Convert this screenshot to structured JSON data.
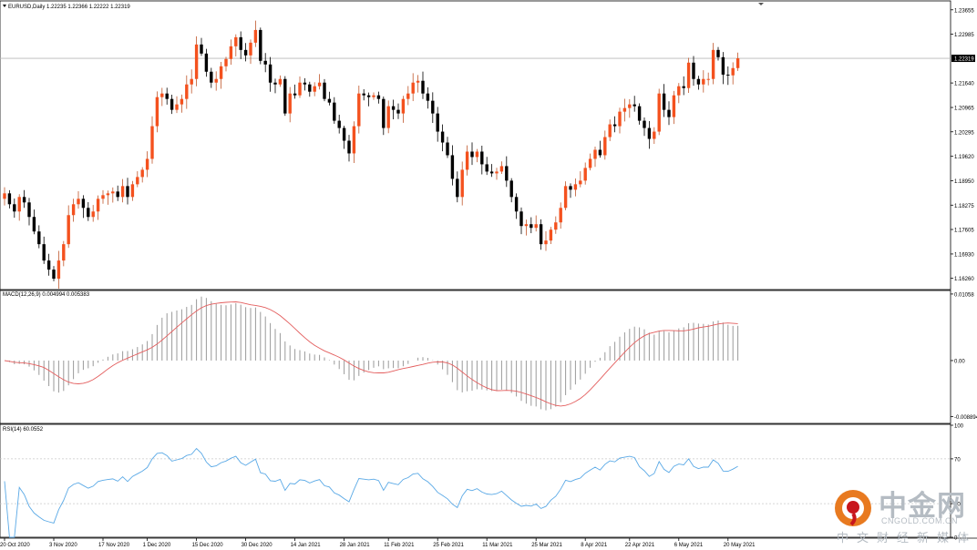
{
  "chart_data": [
    {
      "type": "candlestick",
      "panel": "price",
      "header": "EURUSD,Daily  1.22235 1.22366 1.22222 1.22319",
      "symbol": "EURUSD",
      "timeframe": "Daily",
      "last_price_label": "1.22319",
      "ylim": [
        1.1595,
        1.2385
      ],
      "y_ticks": [
        "1.23655",
        "1.22985",
        "1.22319",
        "1.21640",
        "1.20965",
        "1.20295",
        "1.19620",
        "1.18950",
        "1.18275",
        "1.17605",
        "1.16930",
        "1.16260"
      ],
      "x_ticks": [
        "20 Oct 2020",
        "3 Nov 2020",
        "17 Nov 2020",
        "1 Dec 2020",
        "15 Dec 2020",
        "30 Dec 2020",
        "14 Jan 2021",
        "28 Jan 2021",
        "11 Feb 2021",
        "25 Feb 2021",
        "11 Mar 2021",
        "25 Mar 2021",
        "8 Apr 2021",
        "22 Apr 2021",
        "6 May 2021",
        "20 May 2021"
      ],
      "bull_color": "#f4511e",
      "bear_color": "#000000",
      "closes": [
        1.186,
        1.183,
        1.181,
        1.185,
        1.1835,
        1.1795,
        1.1755,
        1.172,
        1.1675,
        1.165,
        1.1625,
        1.1675,
        1.172,
        1.18,
        1.183,
        1.1845,
        1.182,
        1.1795,
        1.181,
        1.1845,
        1.1855,
        1.186,
        1.1865,
        1.185,
        1.188,
        1.185,
        1.1885,
        1.1905,
        1.1925,
        1.1955,
        1.2045,
        1.2125,
        1.2135,
        1.212,
        1.209,
        1.2105,
        1.212,
        1.216,
        1.2175,
        1.227,
        1.2245,
        1.2195,
        1.2165,
        1.2175,
        1.221,
        1.223,
        1.2265,
        1.229,
        1.2255,
        1.224,
        1.2275,
        1.231,
        1.2225,
        1.2215,
        1.2165,
        1.216,
        1.2175,
        1.208,
        1.2135,
        1.213,
        1.2165,
        1.216,
        1.214,
        1.2155,
        1.2165,
        1.212,
        1.211,
        1.206,
        1.204,
        1.2005,
        1.197,
        1.2045,
        1.2135,
        1.213,
        1.2125,
        1.213,
        1.212,
        1.204,
        1.21,
        1.209,
        1.208,
        1.212,
        1.2135,
        1.2165,
        1.217,
        1.2135,
        1.2115,
        1.208,
        1.203,
        1.2,
        1.1965,
        1.19,
        1.185,
        1.1925,
        1.1975,
        1.196,
        1.1975,
        1.194,
        1.192,
        1.1915,
        1.192,
        1.1935,
        1.1895,
        1.185,
        1.181,
        1.177,
        1.1775,
        1.1765,
        1.1775,
        1.172,
        1.173,
        1.176,
        1.178,
        1.182,
        1.188,
        1.187,
        1.1885,
        1.1895,
        1.193,
        1.1955,
        1.198,
        1.1965,
        1.2015,
        1.205,
        1.2045,
        1.2085,
        1.2095,
        1.2105,
        1.21,
        1.206,
        1.204,
        1.201,
        1.203,
        1.2135,
        1.209,
        1.207,
        1.213,
        1.2155,
        1.215,
        1.222,
        1.2175,
        1.216,
        1.2175,
        1.2175,
        1.2255,
        1.2235,
        1.2187,
        1.2185,
        1.2205,
        1.2232
      ]
    },
    {
      "type": "line",
      "panel": "macd",
      "header": "MACD(12,26,9) 0.004994 0.005383",
      "name": "MACD(12,26,9)",
      "ylim": [
        -0.01,
        0.011
      ],
      "y_ticks": [
        "0.01058",
        "0.00",
        "-0.008894"
      ],
      "histogram_color": "#9a9a9a",
      "signal_color": "#e35d5d"
    },
    {
      "type": "line",
      "panel": "rsi",
      "header": "RSI(14) 60.0552",
      "name": "RSI(14)",
      "ylim": [
        0,
        100
      ],
      "levels": [
        30,
        70
      ],
      "y_ticks": [
        "100",
        "70",
        "30",
        "0"
      ],
      "line_color": "#5aa9e6"
    }
  ],
  "watermark": {
    "name": "中金网",
    "url": "CNGOLD.COM.CN",
    "tagline": "中文财经新媒体"
  }
}
